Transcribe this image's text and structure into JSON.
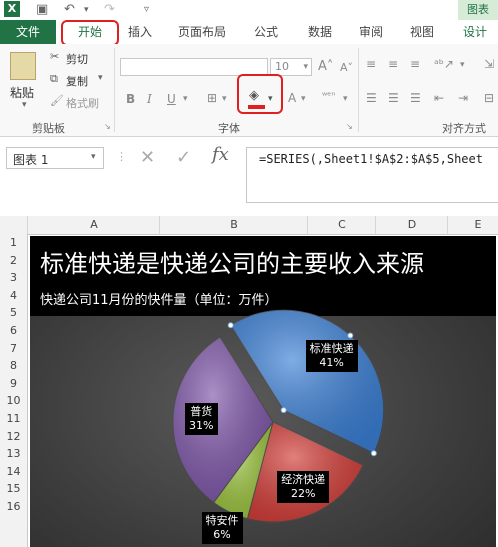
{
  "app": {
    "chart_tools_label": "图表"
  },
  "tabs": {
    "file": "文件",
    "home": "开始",
    "insert": "插入",
    "page_layout": "页面布局",
    "formulas": "公式",
    "data": "数据",
    "review": "审阅",
    "view": "视图",
    "design": "设计"
  },
  "ribbon": {
    "clipboard": {
      "paste": "粘贴",
      "cut": "剪切",
      "copy": "复制",
      "format_painter": "格式刷",
      "group_label": "剪贴板"
    },
    "font": {
      "size": "10",
      "group_label": "字体"
    },
    "alignment": {
      "group_label": "对齐方式"
    }
  },
  "formula_bar": {
    "name_box": "图表 1",
    "fx": "fx",
    "formula": "=SERIES(,Sheet1!$A$2:$A$5,Sheet"
  },
  "columns": [
    "A",
    "B",
    "C",
    "D",
    "E"
  ],
  "rows": [
    "1",
    "2",
    "3",
    "4",
    "5",
    "6",
    "7",
    "8",
    "9",
    "10",
    "11",
    "12",
    "13",
    "14",
    "15",
    "16"
  ],
  "chart_data": {
    "type": "pie",
    "title": "标准快递是快递公司的主要收入来源",
    "subtitle": "快递公司11月份的快件量（单位：万件）",
    "categories": [
      "标准快递",
      "经济快递",
      "特安件",
      "普货"
    ],
    "values": [
      41,
      22,
      6,
      31
    ],
    "labels": [
      "41%",
      "22%",
      "6%",
      "31%"
    ],
    "colors": [
      "#3a7fd5",
      "#d23b36",
      "#99c23a",
      "#7d55a8"
    ],
    "legend": "none"
  }
}
